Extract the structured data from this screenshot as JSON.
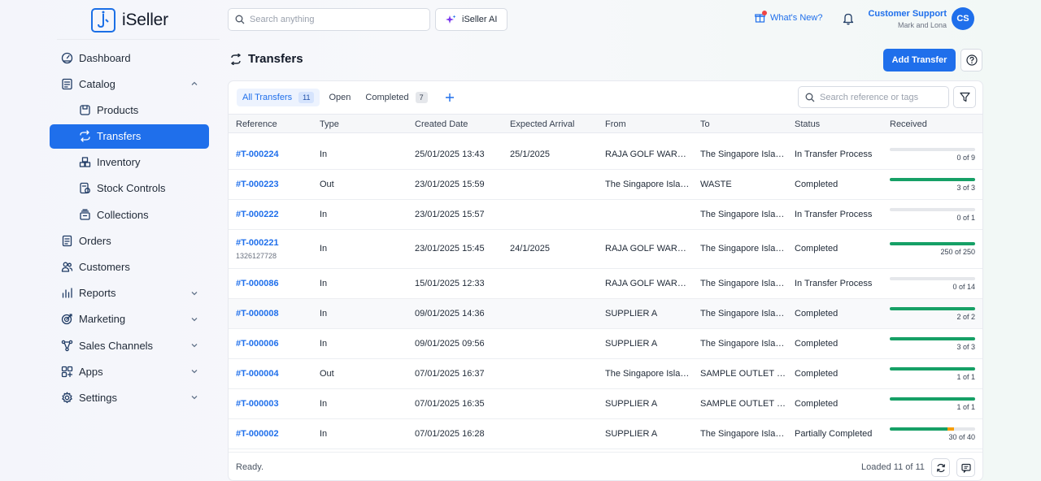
{
  "app": {
    "logo_text": "iSeller"
  },
  "sidebar": {
    "items": [
      {
        "label": "Dashboard",
        "icon": "dashboard-icon"
      },
      {
        "label": "Catalog",
        "icon": "catalog-icon",
        "expanded": true
      },
      {
        "label": "Products",
        "icon": "products-icon",
        "sub": true
      },
      {
        "label": "Transfers",
        "icon": "transfers-icon",
        "sub": true,
        "active": true
      },
      {
        "label": "Inventory",
        "icon": "inventory-icon",
        "sub": true
      },
      {
        "label": "Stock Controls",
        "icon": "stock-controls-icon",
        "sub": true
      },
      {
        "label": "Collections",
        "icon": "collections-icon",
        "sub": true
      },
      {
        "label": "Orders",
        "icon": "orders-icon"
      },
      {
        "label": "Customers",
        "icon": "customers-icon"
      },
      {
        "label": "Reports",
        "icon": "reports-icon",
        "expandable": true
      },
      {
        "label": "Marketing",
        "icon": "marketing-icon",
        "expandable": true
      },
      {
        "label": "Sales Channels",
        "icon": "sales-channels-icon",
        "expandable": true
      },
      {
        "label": "Apps",
        "icon": "apps-icon",
        "expandable": true
      },
      {
        "label": "Settings",
        "icon": "settings-icon",
        "expandable": true
      }
    ]
  },
  "topbar": {
    "search_placeholder": "Search anything",
    "ai_label": "iSeller AI",
    "whats_new_label": "What's New?",
    "user_name": "Customer Support",
    "user_sub": "Mark and Lona",
    "avatar_initials": "CS"
  },
  "page": {
    "title": "Transfers",
    "add_button": "Add Transfer"
  },
  "tabs": [
    {
      "label": "All Transfers",
      "count": "11",
      "active": true
    },
    {
      "label": "Open",
      "count": ""
    },
    {
      "label": "Completed",
      "count": "7"
    }
  ],
  "table_search_placeholder": "Search reference or tags",
  "columns": [
    "Reference",
    "Type",
    "Created Date",
    "Expected Arrival",
    "From",
    "To",
    "Status",
    "Received"
  ],
  "rows": [
    {
      "ref": "#T-000224",
      "sub": "",
      "type": "In",
      "created": "25/01/2025 13:43",
      "expected": "25/1/2025",
      "from": "RAJA GOLF WAREHOUSE",
      "to": "The Singapore Island Country Club",
      "status": "In Transfer Process",
      "received": "0 of 9",
      "progress": 0,
      "partial": 0
    },
    {
      "ref": "#T-000223",
      "sub": "",
      "type": "Out",
      "created": "23/01/2025 15:59",
      "expected": "",
      "from": "The Singapore Island Country Club",
      "to": "WASTE",
      "status": "Completed",
      "received": "3 of 3",
      "progress": 1,
      "partial": 0
    },
    {
      "ref": "#T-000222",
      "sub": "",
      "type": "In",
      "created": "23/01/2025 15:57",
      "expected": "",
      "from": "",
      "to": "The Singapore Island Country Club",
      "status": "In Transfer Process",
      "received": "0 of 1",
      "progress": 0,
      "partial": 0
    },
    {
      "ref": "#T-000221",
      "sub": "1326127728",
      "type": "In",
      "created": "23/01/2025 15:45",
      "expected": "24/1/2025",
      "from": "RAJA GOLF WAREHOUSE",
      "to": "The Singapore Island Country Club",
      "status": "Completed",
      "received": "250 of 250",
      "progress": 1,
      "partial": 0
    },
    {
      "ref": "#T-000086",
      "sub": "",
      "type": "In",
      "created": "15/01/2025 12:33",
      "expected": "",
      "from": "RAJA GOLF WAREHOUSE",
      "to": "The Singapore Island Country Club",
      "status": "In Transfer Process",
      "received": "0 of 14",
      "progress": 0,
      "partial": 0
    },
    {
      "ref": "#T-000008",
      "sub": "",
      "type": "In",
      "created": "09/01/2025 14:36",
      "expected": "",
      "from": "SUPPLIER A",
      "to": "The Singapore Island Country Club",
      "status": "Completed",
      "received": "2 of 2",
      "progress": 1,
      "partial": 0
    },
    {
      "ref": "#T-000006",
      "sub": "",
      "type": "In",
      "created": "09/01/2025 09:56",
      "expected": "",
      "from": "SUPPLIER A",
      "to": "The Singapore Island Country Club",
      "status": "Completed",
      "received": "3 of 3",
      "progress": 1,
      "partial": 0
    },
    {
      "ref": "#T-000004",
      "sub": "",
      "type": "Out",
      "created": "07/01/2025 16:37",
      "expected": "",
      "from": "The Singapore Island Country Club",
      "to": "SAMPLE OUTLET PIK",
      "status": "Completed",
      "received": "1 of 1",
      "progress": 1,
      "partial": 0
    },
    {
      "ref": "#T-000003",
      "sub": "",
      "type": "In",
      "created": "07/01/2025 16:35",
      "expected": "",
      "from": "SUPPLIER A",
      "to": "SAMPLE OUTLET PIK",
      "status": "Completed",
      "received": "1 of 1",
      "progress": 1,
      "partial": 0
    },
    {
      "ref": "#T-000002",
      "sub": "",
      "type": "In",
      "created": "07/01/2025 16:28",
      "expected": "",
      "from": "SUPPLIER A",
      "to": "The Singapore Island Country Club",
      "status": "Partially Completed",
      "received": "30 of 40",
      "progress": 0.68,
      "partial": 0.07
    }
  ],
  "footer": {
    "status": "Ready.",
    "loaded": "Loaded 11 of 11"
  },
  "colors": {
    "accent": "#1f6feb",
    "progress_complete": "#16a066",
    "progress_partial": "#f59e0b",
    "progress_track": "#e5e7eb"
  }
}
